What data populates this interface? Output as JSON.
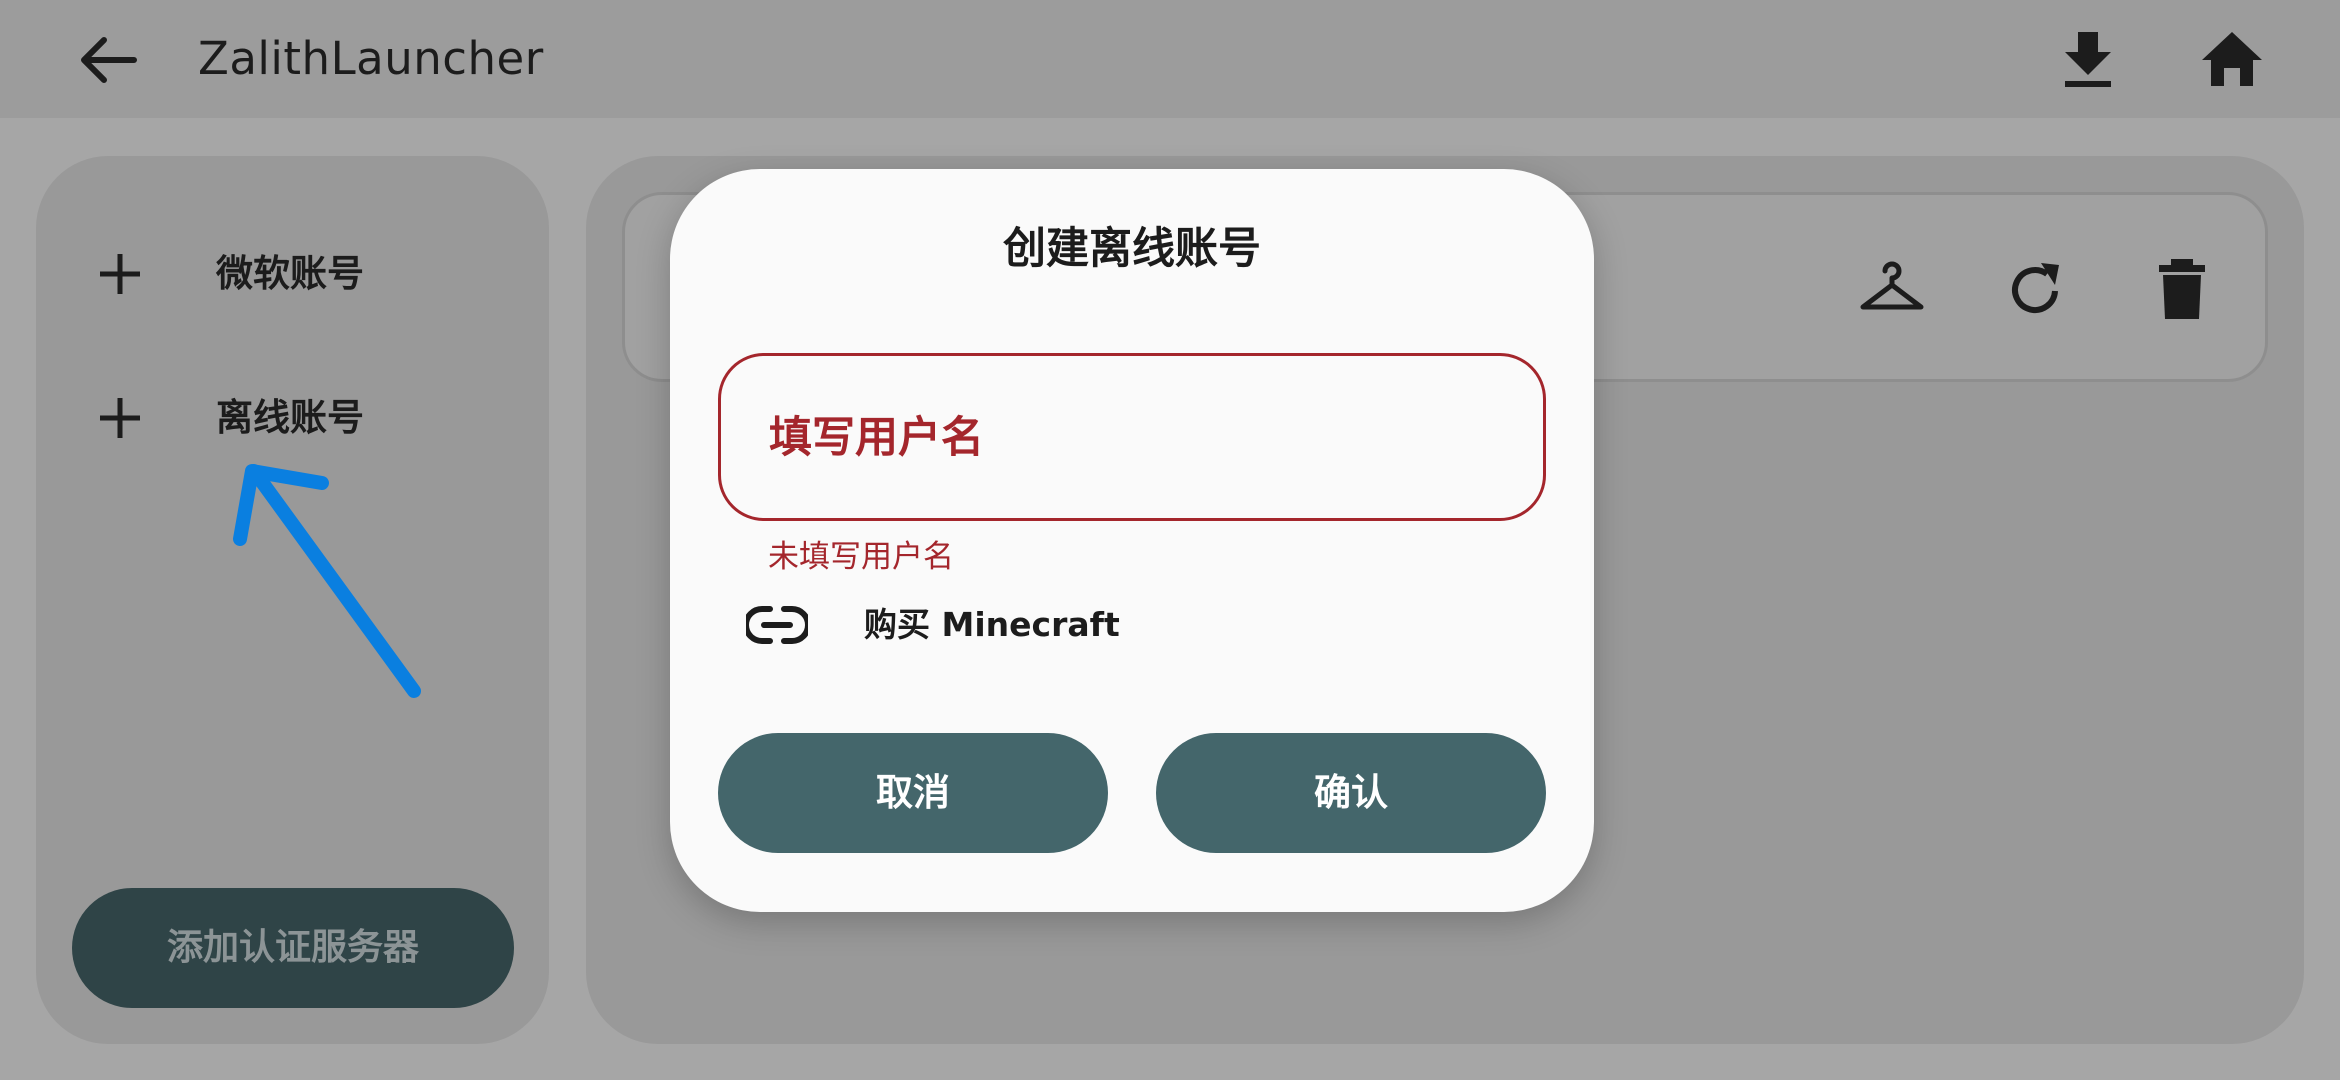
{
  "app": {
    "title": "ZalithLauncher"
  },
  "toolbar": {
    "back_icon": "arrow-left-icon",
    "download_icon": "download-icon",
    "home_icon": "home-icon"
  },
  "sidebar": {
    "items": [
      {
        "label": "微软账号",
        "icon": "plus-icon"
      },
      {
        "label": "离线账号",
        "icon": "plus-icon"
      }
    ],
    "add_auth_server_label": "添加认证服务器"
  },
  "account_card": {
    "icons": [
      "hanger-icon",
      "refresh-icon",
      "trash-icon"
    ]
  },
  "dialog": {
    "title": "创建离线账号",
    "username_field": {
      "value": "",
      "placeholder": "填写用户名"
    },
    "error": "未填写用户名",
    "buy_link": "购买 Minecraft",
    "cancel_label": "取消",
    "confirm_label": "确认"
  },
  "colors": {
    "accent": "#44666b",
    "error": "#a4262c",
    "annotation_arrow": "#0a7fe0"
  }
}
